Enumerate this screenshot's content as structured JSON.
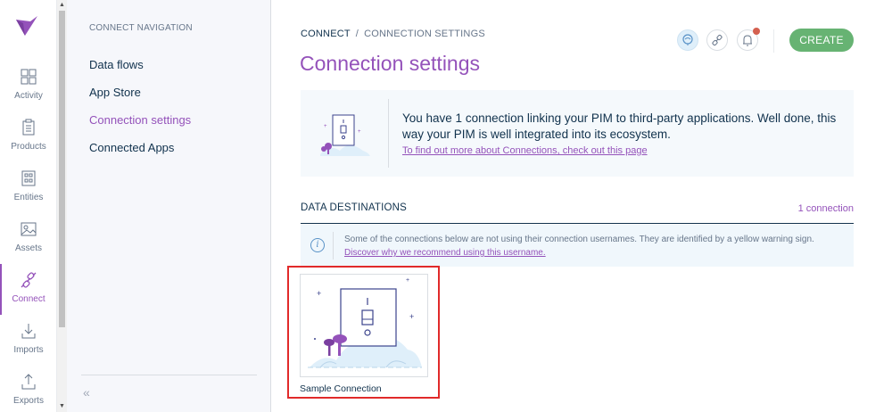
{
  "main_menu": {
    "items": [
      {
        "label": "Activity",
        "icon": "activity-icon"
      },
      {
        "label": "Products",
        "icon": "products-icon"
      },
      {
        "label": "Entities",
        "icon": "entities-icon"
      },
      {
        "label": "Assets",
        "icon": "assets-icon"
      },
      {
        "label": "Connect",
        "icon": "connect-icon",
        "active": true
      },
      {
        "label": "Imports",
        "icon": "imports-icon"
      },
      {
        "label": "Exports",
        "icon": "exports-icon"
      }
    ],
    "accent": "#9452ba"
  },
  "sub_nav": {
    "title": "CONNECT NAVIGATION",
    "items": [
      {
        "label": "Data flows"
      },
      {
        "label": "App Store"
      },
      {
        "label": "Connection settings",
        "active": true
      },
      {
        "label": "Connected Apps"
      }
    ],
    "collapse_icon": "«"
  },
  "breadcrumb": {
    "root": "CONNECT",
    "separator": "/",
    "current": "CONNECTION SETTINGS"
  },
  "page": {
    "title": "Connection settings",
    "create_label": "CREATE"
  },
  "info_box": {
    "text": "You have 1 connection linking your PIM to third-party applications. Well done, this way your PIM is well integrated into its ecosystem.",
    "link": "To find out more about Connections, check out this page"
  },
  "section": {
    "title": "DATA DESTINATIONS",
    "count": "1 connection"
  },
  "helper": {
    "icon": "i",
    "text": "Some of the connections below are not using their connection usernames. They are identified by a yellow warning sign.",
    "link": "Discover why we recommend using this username."
  },
  "connections": [
    {
      "label": "Sample Connection"
    }
  ],
  "colors": {
    "purple": "#9452ba",
    "green": "#67b373",
    "highlight": "#e12a2a"
  }
}
